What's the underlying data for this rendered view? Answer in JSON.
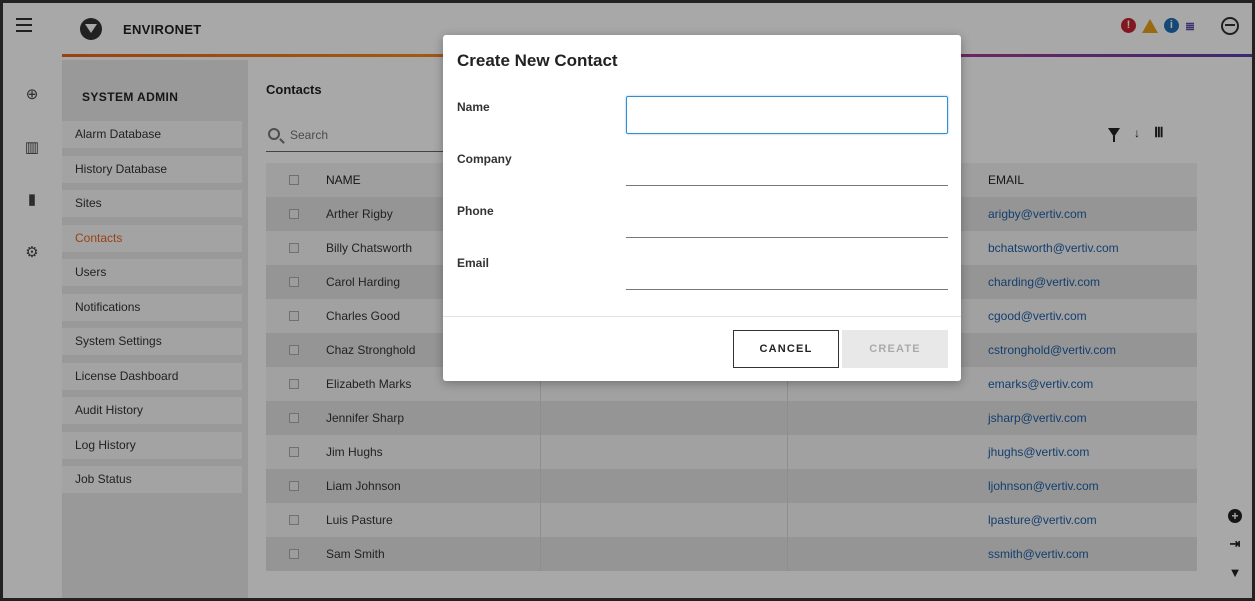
{
  "app": {
    "name": "ENVIRONET"
  },
  "header": {
    "status_icons": [
      "alert-critical-icon",
      "alert-warning-icon",
      "info-icon",
      "network-icon"
    ],
    "status_glyphs": {
      "critical": "!",
      "info": "i",
      "network": "≣"
    }
  },
  "rail": {
    "icons": [
      "globe-icon",
      "dashboard-icon",
      "devices-icon",
      "settings-icon"
    ]
  },
  "sidebar": {
    "title": "SYSTEM ADMIN",
    "items": [
      {
        "label": "Alarm Database"
      },
      {
        "label": "History Database"
      },
      {
        "label": "Sites"
      },
      {
        "label": "Contacts",
        "active": true
      },
      {
        "label": "Users"
      },
      {
        "label": "Notifications"
      },
      {
        "label": "System Settings"
      },
      {
        "label": "License Dashboard"
      },
      {
        "label": "Audit History"
      },
      {
        "label": "Log History"
      },
      {
        "label": "Job Status"
      }
    ]
  },
  "main": {
    "title": "Contacts",
    "search_placeholder": "Search",
    "columns": {
      "name": "NAME",
      "email": "EMAIL"
    },
    "rows": [
      {
        "name": "Arther Rigby",
        "email": "arigby@vertiv.com"
      },
      {
        "name": "Billy Chatsworth",
        "email": "bchatsworth@vertiv.com"
      },
      {
        "name": "Carol Harding",
        "email": "charding@vertiv.com"
      },
      {
        "name": "Charles Good",
        "email": "cgood@vertiv.com"
      },
      {
        "name": "Chaz Stronghold",
        "email": "cstronghold@vertiv.com"
      },
      {
        "name": "Elizabeth Marks",
        "email": "emarks@vertiv.com"
      },
      {
        "name": "Jennifer Sharp",
        "email": "jsharp@vertiv.com"
      },
      {
        "name": "Jim Hughs",
        "email": "jhughs@vertiv.com"
      },
      {
        "name": "Liam Johnson",
        "email": "ljohnson@vertiv.com"
      },
      {
        "name": "Luis Pasture",
        "email": "lpasture@vertiv.com"
      },
      {
        "name": "Sam Smith",
        "email": "ssmith@vertiv.com"
      }
    ]
  },
  "modal": {
    "title": "Create New Contact",
    "fields": {
      "name": {
        "label": "Name",
        "value": ""
      },
      "company": {
        "label": "Company",
        "value": ""
      },
      "phone": {
        "label": "Phone",
        "value": ""
      },
      "email": {
        "label": "Email",
        "value": ""
      }
    },
    "cancel_label": "CANCEL",
    "create_label": "CREATE"
  },
  "colors": {
    "accent": "#e8651f",
    "link": "#1f5fa8",
    "focus": "#2f8fd0"
  }
}
